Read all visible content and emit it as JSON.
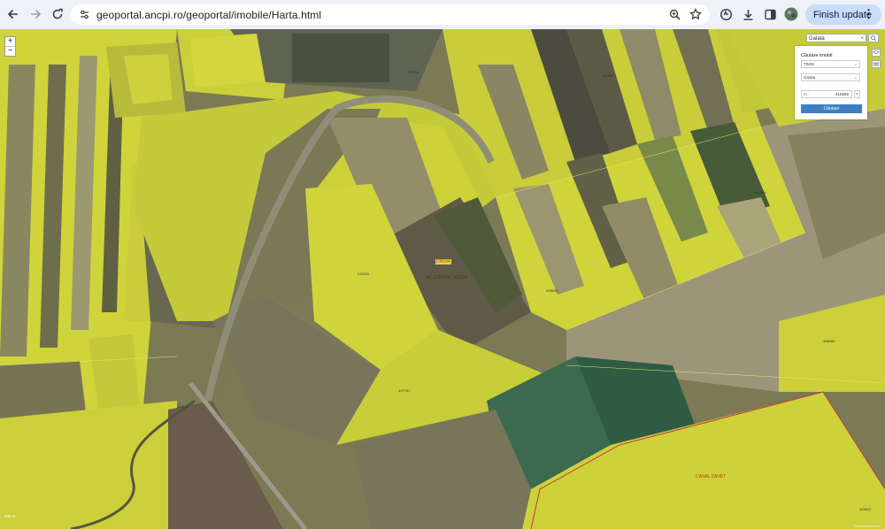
{
  "browser": {
    "url": "geoportal.ancpi.ro/geoportal/imobile/Harta.html",
    "update_label": "Finish update",
    "nav_icons": [
      "back-arrow-icon",
      "forward-arrow-icon",
      "reload-icon"
    ],
    "toolbar_icons": [
      "zoom-icon",
      "bookmark-star-icon",
      "extension-icon",
      "download-icon",
      "side-panel-icon",
      "profile-avatar"
    ]
  },
  "map": {
    "zoom": {
      "in": "+",
      "out": "−"
    },
    "search": {
      "value": "Galata",
      "clear": "×"
    },
    "panel": {
      "title": "Căutare imobil",
      "county": "TIMIS",
      "locality": "Galata",
      "id_placeholder": "ID:",
      "id_value": "410292",
      "clear": "×",
      "search_button": "Căutare"
    },
    "labels": {
      "a": "406011",
      "b": "410292",
      "c": "407934",
      "d": "410284",
      "e": "408045",
      "f": "408104",
      "g": "407751",
      "h": "408089",
      "i": "405810"
    },
    "overlays": {
      "road": "DN59A",
      "street": "AC STRADA TEDOR",
      "canal": "CANAL ZANET"
    },
    "scale": "200 m",
    "attribution": "Powered by Esri"
  }
}
